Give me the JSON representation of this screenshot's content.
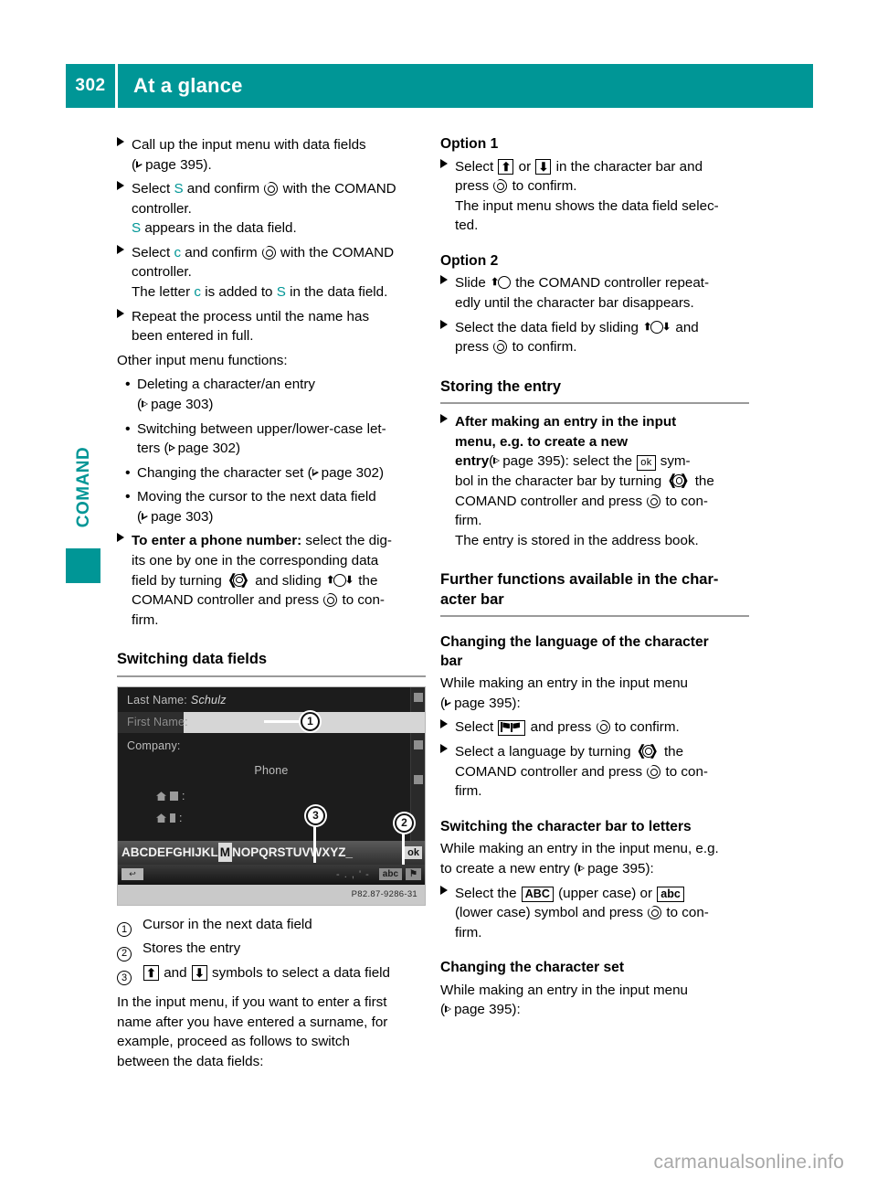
{
  "header": {
    "page_number": "302",
    "title": "At a glance"
  },
  "side_tab": {
    "label": "COMAND"
  },
  "left_column": {
    "steps_intro": [
      {
        "lines": [
          "Call up the input menu with data fields",
          "(▷ page 395)."
        ]
      },
      {
        "lines": [
          "Select S and confirm ◌ with the COMAND",
          "controller.",
          "S appears in the data field."
        ]
      },
      {
        "lines": [
          "Select c and confirm ◌ with the COMAND",
          "controller.",
          "The letter c is added to S in the data field."
        ]
      },
      {
        "lines": [
          "Repeat the process until the name has",
          "been entered in full."
        ]
      }
    ],
    "step1_text_a": "Call up the input menu with data fields",
    "step1_ref": "page 395).",
    "step2_a": "Select ",
    "step2_letter": "S",
    "step2_b": " and confirm ",
    "step2_c": " with the COMAND",
    "step2_d": "controller.",
    "step2_e_letter": "S",
    "step2_e": " appears in the data field.",
    "step3_a": "Select ",
    "step3_letter": "c",
    "step3_b": " and confirm ",
    "step3_c": " with the COMAND",
    "step3_d": "controller.",
    "step3_e1": "The letter ",
    "step3_e_letter1": "c",
    "step3_e2": " is added to ",
    "step3_e_letter2": "S",
    "step3_e3": " in the data field.",
    "step4_a": "Repeat the process until the name has",
    "step4_b": "been entered in full.",
    "other_functions_intro": "Other input menu functions:",
    "bullets": [
      {
        "line1": "Deleting a character/an entry",
        "line2_ref": "page 303)"
      },
      {
        "line1": "Switching between upper/lower-case let-",
        "line2_pre": "ters (",
        "line2_ref": "page 302)"
      },
      {
        "line1_pre": "Changing the character set (",
        "line1_ref": "page 302)"
      },
      {
        "line1": "Moving the cursor to the next data field",
        "line2_ref": "page 303)"
      }
    ],
    "phone_step": {
      "bold": "To enter a phone number:",
      "a": " select the dig-",
      "b": "its one by one in the corresponding data",
      "c_pre": "field by turning ",
      "c_mid": " and sliding ",
      "c_post": " the",
      "d_pre": "COMAND controller and press ",
      "d_post": " to con-",
      "e": "firm."
    },
    "section_heading": "Switching data fields",
    "figure": {
      "rows": {
        "last_name_label": "Last Name:",
        "last_name_value": "Schulz",
        "first_name_label": "First Name:",
        "company_label": "Company:",
        "phone_label": "Phone"
      },
      "charbar_letters_before": "ABCDEFGHIJKL",
      "charbar_selected": "M",
      "charbar_letters_after": "NOPQRSTUVWXYZ_",
      "charbar_ok": "ok",
      "charbar2_back": "↩",
      "charbar2_mid": "- . , ' -",
      "charbar2_chip_abc": "abc",
      "charbar2_chip_flag": "⚑",
      "caption_code": "P82.87-9286-31",
      "callouts": [
        "1",
        "2",
        "3"
      ]
    },
    "legend": [
      {
        "num": "1",
        "text": "Cursor in the next data field"
      },
      {
        "num": "2",
        "text": "Stores the entry"
      },
      {
        "num": "3",
        "text_pre": "",
        "arrow_up": "⬆",
        "text_mid": " and ",
        "arrow_down": "⬇",
        "text_post": " symbols to select a data field"
      }
    ],
    "closing_paragraph": [
      "In the input menu, if you want to enter a first",
      "name after you have entered a surname, for",
      "example, proceed as follows to switch",
      "between the data fields:"
    ]
  },
  "right_column": {
    "option1_heading": "Option 1",
    "option1_step": {
      "a": "Select ",
      "or": " or ",
      "b": " in the character bar and",
      "c_pre": "press ",
      "c_post": " to confirm.",
      "d": "The input menu shows the data field selec-",
      "e": "ted."
    },
    "option2_heading": "Option 2",
    "option2_steps": {
      "s1_pre": "Slide ",
      "s1_post": " the COMAND controller repeat-",
      "s1_b": "edly until the character bar disappears.",
      "s2_pre": "Select the data field by sliding ",
      "s2_post": " and",
      "s2_b_pre": "press ",
      "s2_b_post": " to confirm."
    },
    "storing_heading": "Storing the entry",
    "storing_step": {
      "b1": "After making an entry in the input",
      "b2": "menu, e.g. to create a new",
      "b3_bold": "entry",
      "b3_ref": "page 395): select the ",
      "b3_ok": "ok",
      "b3_post": " sym-",
      "b4_pre": "bol in the character bar by turning ",
      "b4_post": " the",
      "b5_pre": "COMAND controller and press ",
      "b5_post": " to con-",
      "b6": "firm.",
      "b7": "The entry is stored in the address book."
    },
    "further_heading_l1": "Further functions available in the char-",
    "further_heading_l2": "acter bar",
    "lang_heading_l1": "Changing the language of the character",
    "lang_heading_l2": "bar",
    "lang_intro_l1": "While making an entry in the input menu",
    "lang_intro_ref": "page 395):",
    "lang_step1_pre": "Select ",
    "lang_step1_mid": " and press ",
    "lang_step1_post": " to confirm.",
    "lang_step2_pre": "Select a language by turning ",
    "lang_step2_post": " the",
    "lang_step2_b_pre": "COMAND controller and press ",
    "lang_step2_b_post": " to con-",
    "lang_step2_c": "firm.",
    "letters_heading": "Switching the character bar to letters",
    "letters_intro_l1": "While making an entry in the input menu, e.g.",
    "letters_intro_l2_pre": "to create a new entry (",
    "letters_intro_ref": "page 395):",
    "letters_step_pre": "Select the ",
    "letters_abc": "ABC",
    "letters_mid": " (upper case) or ",
    "letters_abc_lower": "abc",
    "letters_line2_pre": "(lower case) symbol and press ",
    "letters_line2_post": " to con-",
    "letters_line3": "firm.",
    "charset_heading": "Changing the character set",
    "charset_intro_l1": "While making an entry in the input menu",
    "charset_intro_ref": "page 395):"
  },
  "watermark": "carmanualsonline.info",
  "colors": {
    "teal": "#009696",
    "rule": "#9a9a9a"
  }
}
